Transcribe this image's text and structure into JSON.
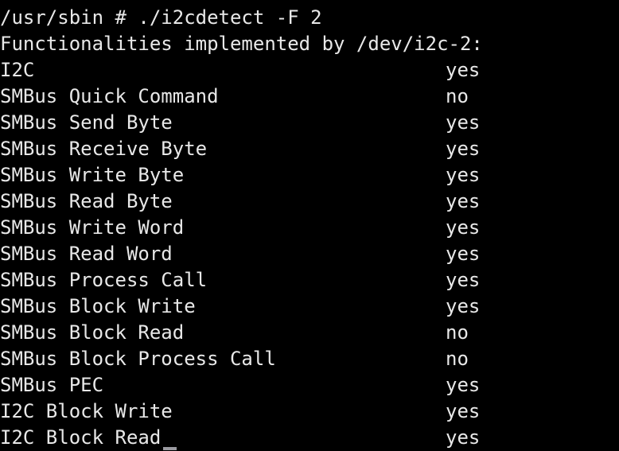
{
  "terminal": {
    "background_color": "#000000",
    "foreground_color": "#e8e8e8",
    "prompt_line": "/usr/sbin # ./i2cdetect -F 2",
    "header_line": "Functionalities implemented by /dev/i2c-2:",
    "clipped_top_line": "",
    "value_column": 33,
    "rows": [
      {
        "label": "I2C",
        "value": "yes"
      },
      {
        "label": "SMBus Quick Command",
        "value": "no"
      },
      {
        "label": "SMBus Send Byte",
        "value": "yes"
      },
      {
        "label": "SMBus Receive Byte",
        "value": "yes"
      },
      {
        "label": "SMBus Write Byte",
        "value": "yes"
      },
      {
        "label": "SMBus Read Byte",
        "value": "yes"
      },
      {
        "label": "SMBus Write Word",
        "value": "yes"
      },
      {
        "label": "SMBus Read Word",
        "value": "yes"
      },
      {
        "label": "SMBus Process Call",
        "value": "yes"
      },
      {
        "label": "SMBus Block Write",
        "value": "yes"
      },
      {
        "label": "SMBus Block Read",
        "value": "no"
      },
      {
        "label": "SMBus Block Process Call",
        "value": "no"
      },
      {
        "label": "SMBus PEC",
        "value": "yes"
      },
      {
        "label": "I2C Block Write",
        "value": "yes"
      },
      {
        "label": "I2C Block Read",
        "value": "yes"
      }
    ]
  }
}
